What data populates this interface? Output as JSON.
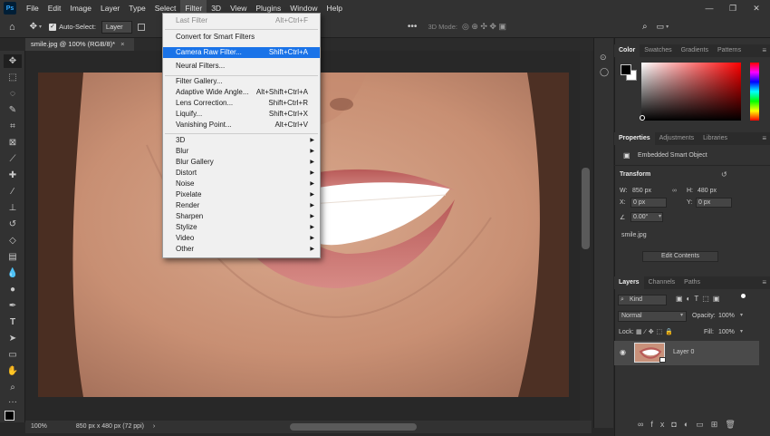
{
  "menubar": {
    "logo": "Ps",
    "items": [
      "File",
      "Edit",
      "Image",
      "Layer",
      "Type",
      "Select",
      "Filter",
      "3D",
      "View",
      "Plugins",
      "Window",
      "Help"
    ]
  },
  "options": {
    "auto_select_label": "Auto-Select:",
    "auto_select_value": "Layer",
    "mode_3d": "3D Mode:"
  },
  "document": {
    "tab_title": "smile.jpg @ 100% (RGB/8)*",
    "zoom": "100%",
    "dimensions": "850 px x 480 px (72 ppi)"
  },
  "filter_menu": {
    "items": [
      {
        "label": "Last Filter",
        "shortcut": "Alt+Ctrl+F",
        "disabled": true
      },
      {
        "label": "Convert for Smart Filters",
        "shortcut": ""
      },
      {
        "label": "Camera Raw Filter...",
        "shortcut": "Shift+Ctrl+A",
        "highlighted": true
      },
      {
        "label": "Neural Filters...",
        "shortcut": ""
      },
      {
        "label": "Filter Gallery...",
        "shortcut": ""
      },
      {
        "label": "Adaptive Wide Angle...",
        "shortcut": "Alt+Shift+Ctrl+A"
      },
      {
        "label": "Lens Correction...",
        "shortcut": "Shift+Ctrl+R"
      },
      {
        "label": "Liquify...",
        "shortcut": "Shift+Ctrl+X"
      },
      {
        "label": "Vanishing Point...",
        "shortcut": "Alt+Ctrl+V"
      },
      {
        "label": "3D",
        "submenu": true
      },
      {
        "label": "Blur",
        "submenu": true
      },
      {
        "label": "Blur Gallery",
        "submenu": true
      },
      {
        "label": "Distort",
        "submenu": true
      },
      {
        "label": "Noise",
        "submenu": true
      },
      {
        "label": "Pixelate",
        "submenu": true
      },
      {
        "label": "Render",
        "submenu": true
      },
      {
        "label": "Sharpen",
        "submenu": true
      },
      {
        "label": "Stylize",
        "submenu": true
      },
      {
        "label": "Video",
        "submenu": true
      },
      {
        "label": "Other",
        "submenu": true
      }
    ]
  },
  "color_panel": {
    "tabs": [
      "Color",
      "Swatches",
      "Gradients",
      "Patterns"
    ],
    "hue_color": "#ff0000"
  },
  "properties_panel": {
    "tabs": [
      "Properties",
      "Adjustments",
      "Libraries"
    ],
    "type": "Embedded Smart Object",
    "section": "Transform",
    "w_label": "W:",
    "w_value": "850 px",
    "h_label": "H:",
    "h_value": "480 px",
    "x_label": "X:",
    "x_value": "0 px",
    "y_label": "Y:",
    "y_value": "0 px",
    "angle": "0.00°",
    "filename": "smile.jpg",
    "edit_button": "Edit Contents"
  },
  "layers_panel": {
    "tabs": [
      "Layers",
      "Channels",
      "Paths"
    ],
    "filter_kind": "Kind",
    "blend_mode": "Normal",
    "opacity_label": "Opacity:",
    "opacity_value": "100%",
    "lock_label": "Lock:",
    "fill_label": "Fill:",
    "fill_value": "100%",
    "layer_name": "Layer 0"
  }
}
